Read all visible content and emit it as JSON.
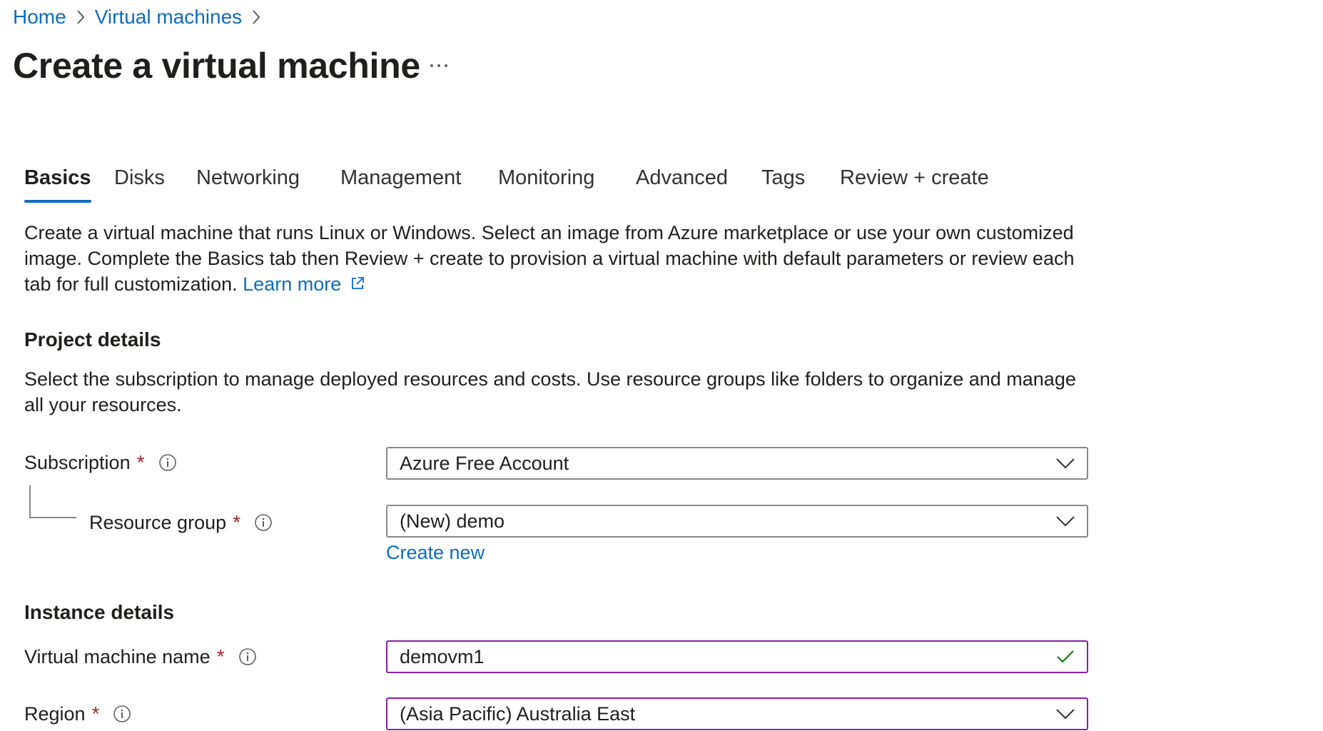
{
  "breadcrumb": {
    "items": [
      "Home",
      "Virtual machines"
    ]
  },
  "page": {
    "title": "Create a virtual machine",
    "more_label": "···"
  },
  "tabs": [
    {
      "label": "Basics",
      "active": true
    },
    {
      "label": "Disks",
      "active": false
    },
    {
      "label": "Networking",
      "active": false
    },
    {
      "label": "Management",
      "active": false
    },
    {
      "label": "Monitoring",
      "active": false
    },
    {
      "label": "Advanced",
      "active": false
    },
    {
      "label": "Tags",
      "active": false
    },
    {
      "label": "Review + create",
      "active": false
    }
  ],
  "intro": {
    "text": "Create a virtual machine that runs Linux or Windows. Select an image from Azure marketplace or use your own customized image. Complete the Basics tab then Review + create to provision a virtual machine with default parameters or review each tab for full customization.",
    "learn_more": "Learn more"
  },
  "project_details": {
    "title": "Project details",
    "description": "Select the subscription to manage deployed resources and costs. Use resource groups like folders to organize and manage all your resources.",
    "subscription": {
      "label": "Subscription",
      "required": "*",
      "value": "Azure Free Account"
    },
    "resource_group": {
      "label": "Resource group",
      "required": "*",
      "value": "(New) demo",
      "create_new": "Create new"
    }
  },
  "instance_details": {
    "title": "Instance details",
    "vm_name": {
      "label": "Virtual machine name",
      "required": "*",
      "value": "demovm1",
      "valid": true
    },
    "region": {
      "label": "Region",
      "required": "*",
      "value": "(Asia Pacific) Australia East"
    }
  },
  "colors": {
    "link": "#0f6cbd",
    "required": "#a4262c",
    "focus_border": "#8a1fa8",
    "valid_check": "#107c10",
    "tab_underline": "#0f6cbd"
  },
  "icons": {
    "breadcrumb_separator": "chevron-right-icon",
    "info": "info-icon",
    "dropdown": "chevron-down-icon",
    "external_link": "external-link-icon",
    "valid": "checkmark-icon"
  }
}
